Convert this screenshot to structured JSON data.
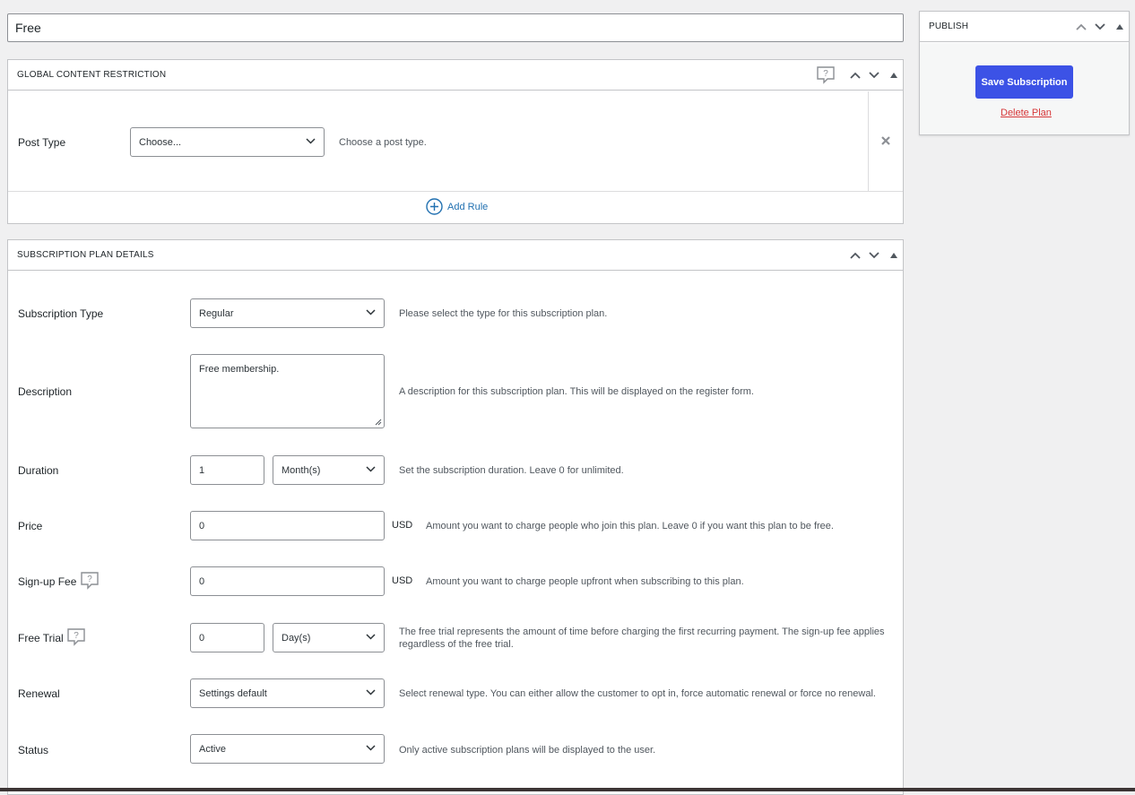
{
  "post_title": "Free",
  "content_restriction": {
    "title": "GLOBAL CONTENT RESTRICTION",
    "post_type_label": "Post Type",
    "post_type_value": "Choose...",
    "post_type_desc": "Choose a post type.",
    "add_rule_label": "Add Rule"
  },
  "plan_details": {
    "title": "SUBSCRIPTION PLAN DETAILS",
    "subscription_type": {
      "label": "Subscription Type",
      "value": "Regular",
      "desc": "Please select the type for this subscription plan."
    },
    "description": {
      "label": "Description",
      "value": "Free membership.",
      "desc": "A description for this subscription plan. This will be displayed on the register form."
    },
    "duration": {
      "label": "Duration",
      "value": "1",
      "unit": "Month(s)",
      "desc": "Set the subscription duration. Leave 0 for unlimited."
    },
    "price": {
      "label": "Price",
      "value": "0",
      "currency": "USD",
      "desc": "Amount you want to charge people who join this plan. Leave 0 if you want this plan to be free."
    },
    "signup_fee": {
      "label": "Sign-up Fee",
      "value": "0",
      "currency": "USD",
      "desc": "Amount you want to charge people upfront when subscribing to this plan."
    },
    "free_trial": {
      "label": "Free Trial",
      "value": "0",
      "unit": "Day(s)",
      "desc_line1": "The free trial represents the amount of time before charging the first recurring payment. The sign-up fee applies",
      "desc_line2": "regardless of the free trial."
    },
    "renewal": {
      "label": "Renewal",
      "value": "Settings default",
      "desc": "Select renewal type. You can either allow the customer to opt in, force automatic renewal or force no renewal."
    },
    "status": {
      "label": "Status",
      "value": "Active",
      "desc": "Only active subscription plans will be displayed to the user."
    }
  },
  "publish": {
    "title": "PUBLISH",
    "save_label": "Save Subscription",
    "delete_label": "Delete Plan"
  },
  "colors": {
    "primary_button": "#3c52e6",
    "delete_link": "#d63638",
    "link": "#2271b1"
  },
  "icons": {
    "help": "help-bubble-icon",
    "chevron_up": "chevron-up-icon",
    "chevron_down": "chevron-down-icon",
    "toggle": "triangle-toggle-icon",
    "remove": "close-icon",
    "add": "plus-circle-icon"
  }
}
